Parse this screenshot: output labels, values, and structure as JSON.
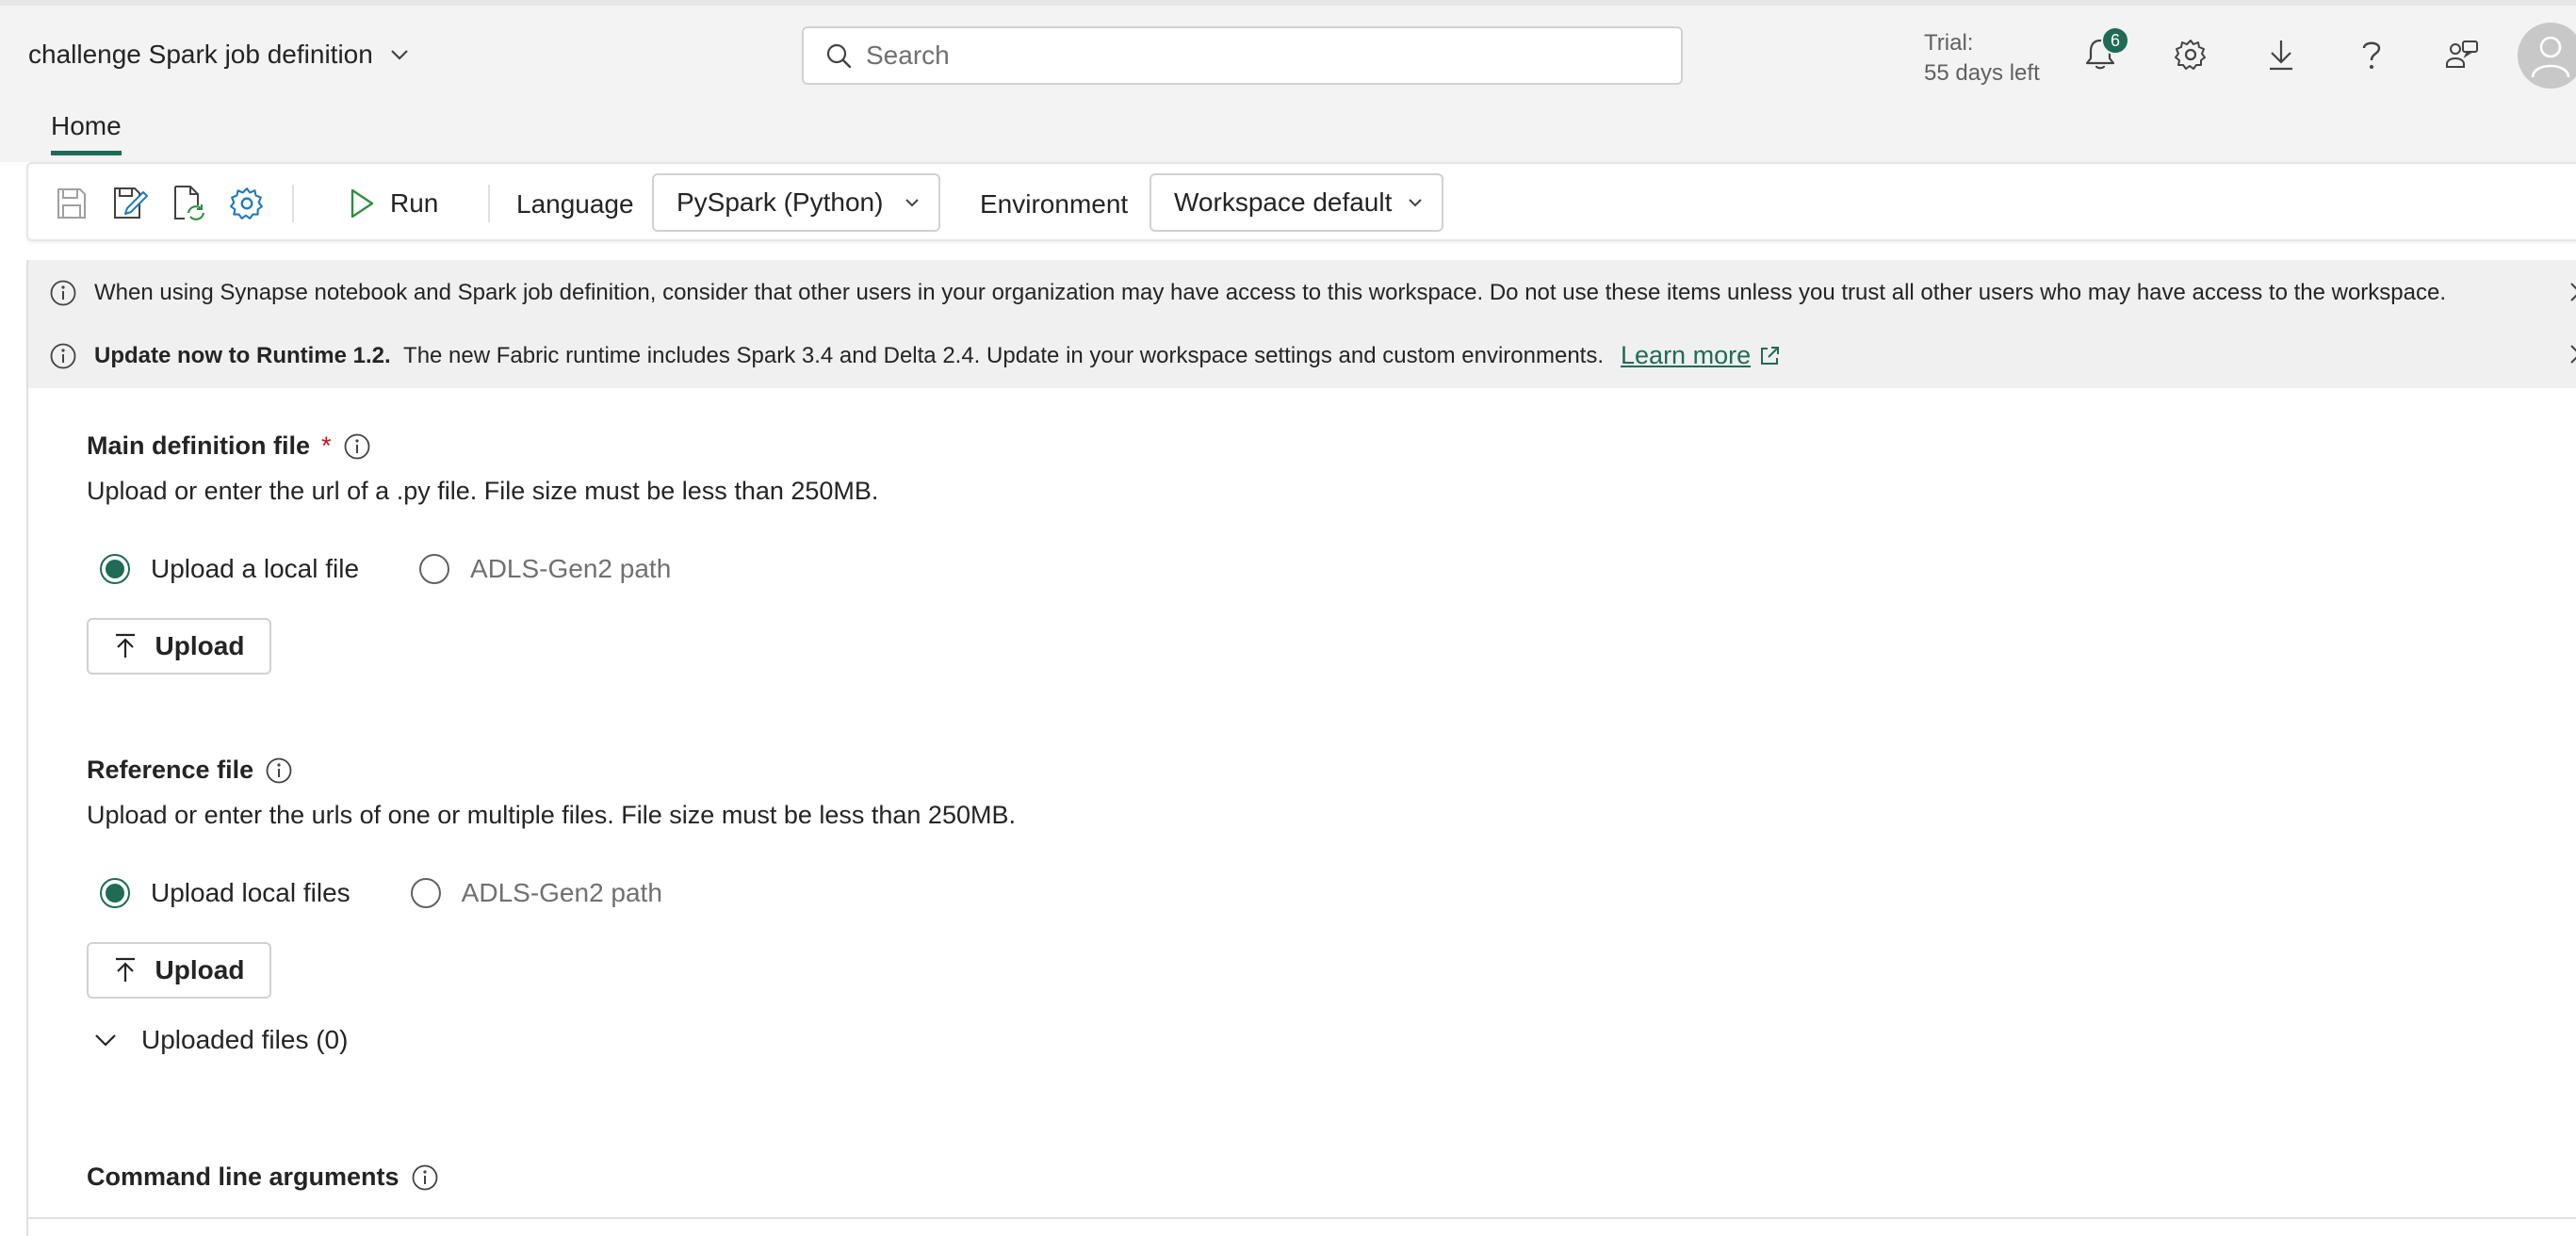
{
  "header": {
    "title": "challenge Spark job definition",
    "search_placeholder": "Search",
    "trial_label": "Trial:",
    "trial_days": "55 days left",
    "notification_count": "6",
    "icons": [
      "bell-icon",
      "gear-icon",
      "download-icon",
      "help-icon",
      "share-people-icon",
      "avatar-icon"
    ]
  },
  "tabs": [
    {
      "label": "Home",
      "active": true
    }
  ],
  "toolbar": {
    "icons": [
      "save-icon",
      "save-as-icon",
      "refresh-file-icon",
      "settings-icon"
    ],
    "run_label": "Run",
    "language_label": "Language",
    "language_value": "PySpark (Python)",
    "environment_label": "Environment",
    "environment_value": "Workspace default"
  },
  "notices": [
    {
      "bold": "",
      "text": "When using Synapse notebook and Spark job definition, consider that other users in your organization may have access to this workspace. Do not use these items unless you trust all other users who may have access to the workspace."
    },
    {
      "bold": "Update now to Runtime 1.2.",
      "text": "The new Fabric runtime includes Spark 3.4 and Delta 2.4. Update in your workspace settings and custom environments.",
      "link": "Learn more"
    }
  ],
  "main_definition": {
    "title": "Main definition file",
    "required_mark": "*",
    "description": "Upload or enter the url of a .py file. File size must be less than 250MB.",
    "option_local": "Upload a local file",
    "option_adls": "ADLS-Gen2 path",
    "selected": "local",
    "upload_label": "Upload"
  },
  "reference_file": {
    "title": "Reference file",
    "description": "Upload or enter the urls of one or multiple files. File size must be less than 250MB.",
    "option_local": "Upload local files",
    "option_adls": "ADLS-Gen2 path",
    "selected": "local",
    "upload_label": "Upload",
    "uploaded_label": "Uploaded files (0)"
  },
  "command_line": {
    "title": "Command line arguments"
  },
  "colors": {
    "accent": "#1f6b56",
    "required": "#c50f1f",
    "banner_bg": "#f0f0f0",
    "chrome_bg": "#f3f3f3"
  }
}
